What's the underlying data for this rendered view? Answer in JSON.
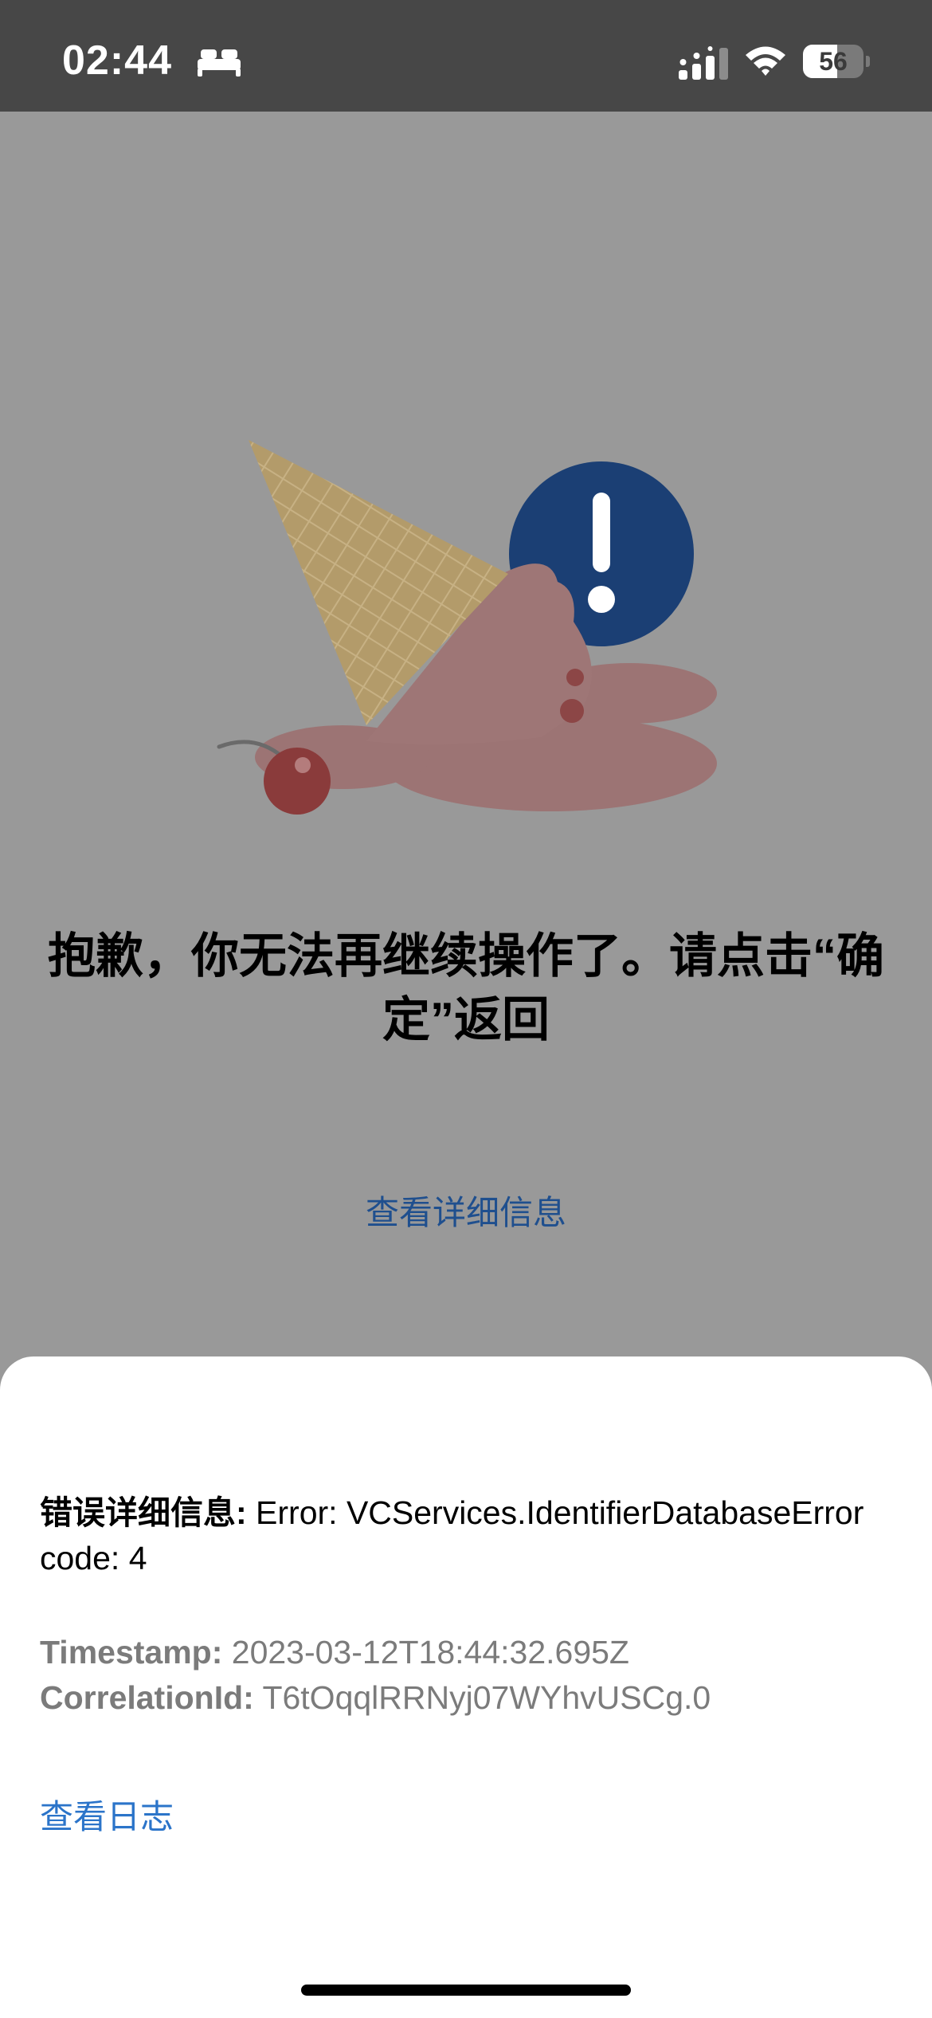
{
  "status_bar": {
    "time": "02:44",
    "battery_level": "56",
    "battery_fraction": 0.56,
    "icons": [
      "bed-icon",
      "cellular-signal-icon",
      "wifi-icon",
      "battery-icon"
    ]
  },
  "error_screen": {
    "message": "抱歉，你无法再继续操作了。请点击“确定”返回",
    "view_details_label": "查看详细信息",
    "illustration": "dropped-ice-cream-cone-with-exclamation-icon"
  },
  "details_sheet": {
    "error_label": "错误详细信息:",
    "error_text": " Error: VCServices.IdentifierDatabaseError code: 4",
    "timestamp_label": "Timestamp:",
    "timestamp_value": " 2023-03-12T18:44:32.695Z",
    "correlation_label": "CorrelationId:",
    "correlation_value": " T6tOqqlRRNyj07WYhvUSCg.0",
    "view_log_label": "查看日志"
  },
  "colors": {
    "status_bar_bg": "#474747",
    "overlay_bg": "#999999",
    "link_dark": "#1f4f8e",
    "link": "#2b74c9",
    "meta_text": "#7b7b7b",
    "exclamation_circle": "#1b3f74"
  }
}
